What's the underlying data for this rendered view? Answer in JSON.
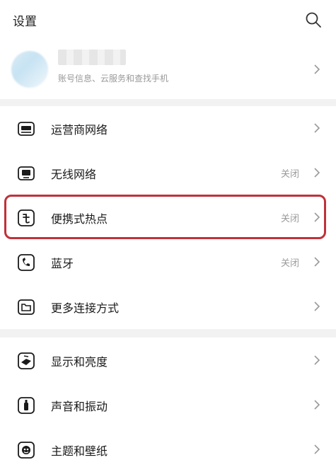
{
  "header": {
    "title": "设置"
  },
  "account": {
    "subtitle": "账号信息、云服务和查找手机"
  },
  "groups": {
    "connectivity": [
      {
        "label": "运营商网络",
        "status": ""
      },
      {
        "label": "无线网络",
        "status": "关闭"
      },
      {
        "label": "便携式热点",
        "status": "关闭"
      },
      {
        "label": "蓝牙",
        "status": "关闭"
      },
      {
        "label": "更多连接方式",
        "status": ""
      }
    ],
    "display": [
      {
        "label": "显示和亮度"
      },
      {
        "label": "声音和振动"
      },
      {
        "label": "主题和壁纸"
      }
    ]
  },
  "colors": {
    "highlight": "#c0313a",
    "separator": "#f2f2f2",
    "muted": "#9a9a9a"
  },
  "icons": [
    "search-icon",
    "carrier-network-icon",
    "wifi-icon",
    "hotspot-icon",
    "bluetooth-icon",
    "more-connections-icon",
    "display-brightness-icon",
    "sound-vibration-icon",
    "theme-wallpaper-icon"
  ]
}
